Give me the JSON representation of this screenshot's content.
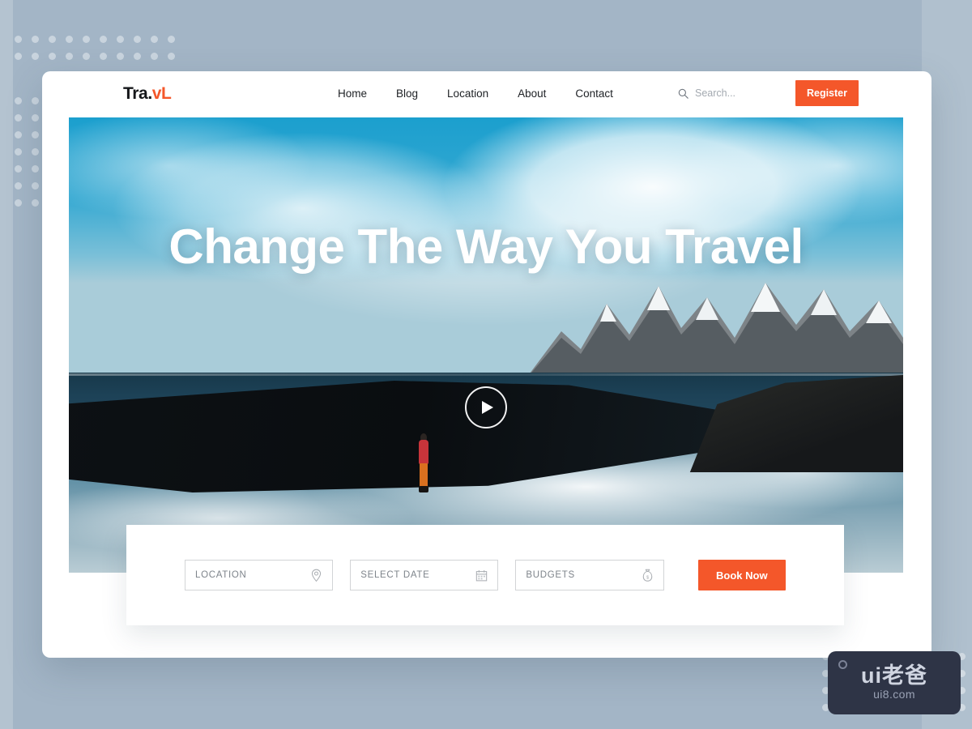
{
  "background": {
    "color": "#a3b5c6",
    "accent_band_color": "#b0c0ce",
    "dot_color": "#ffffff"
  },
  "header": {
    "logo": {
      "primary": "Tra.",
      "accent": "vL",
      "accent_color": "#f4572a"
    },
    "nav": [
      {
        "label": "Home"
      },
      {
        "label": "Blog"
      },
      {
        "label": "Location"
      },
      {
        "label": "About"
      },
      {
        "label": "Contact"
      }
    ],
    "search": {
      "placeholder": "Search...",
      "value": "",
      "icon": "search-icon"
    },
    "register_button": {
      "label": "Register",
      "color": "#f4572a"
    }
  },
  "hero": {
    "title": "Change The Way You Travel",
    "play_button_icon": "play-icon",
    "image_description": "Person in red jacket standing on dark rock at fjord with snowy mountains and mirrored reflection"
  },
  "booking": {
    "fields": [
      {
        "label": "LOCATION",
        "icon": "map-pin-icon",
        "value": ""
      },
      {
        "label": "SELECT DATE",
        "icon": "calendar-icon",
        "value": ""
      },
      {
        "label": "BUDGETS",
        "icon": "money-bag-icon",
        "value": ""
      }
    ],
    "submit_button": {
      "label": "Book Now",
      "color": "#f4572a"
    }
  },
  "watermark": {
    "main": "ui老爸",
    "sub": "ui8.com"
  }
}
